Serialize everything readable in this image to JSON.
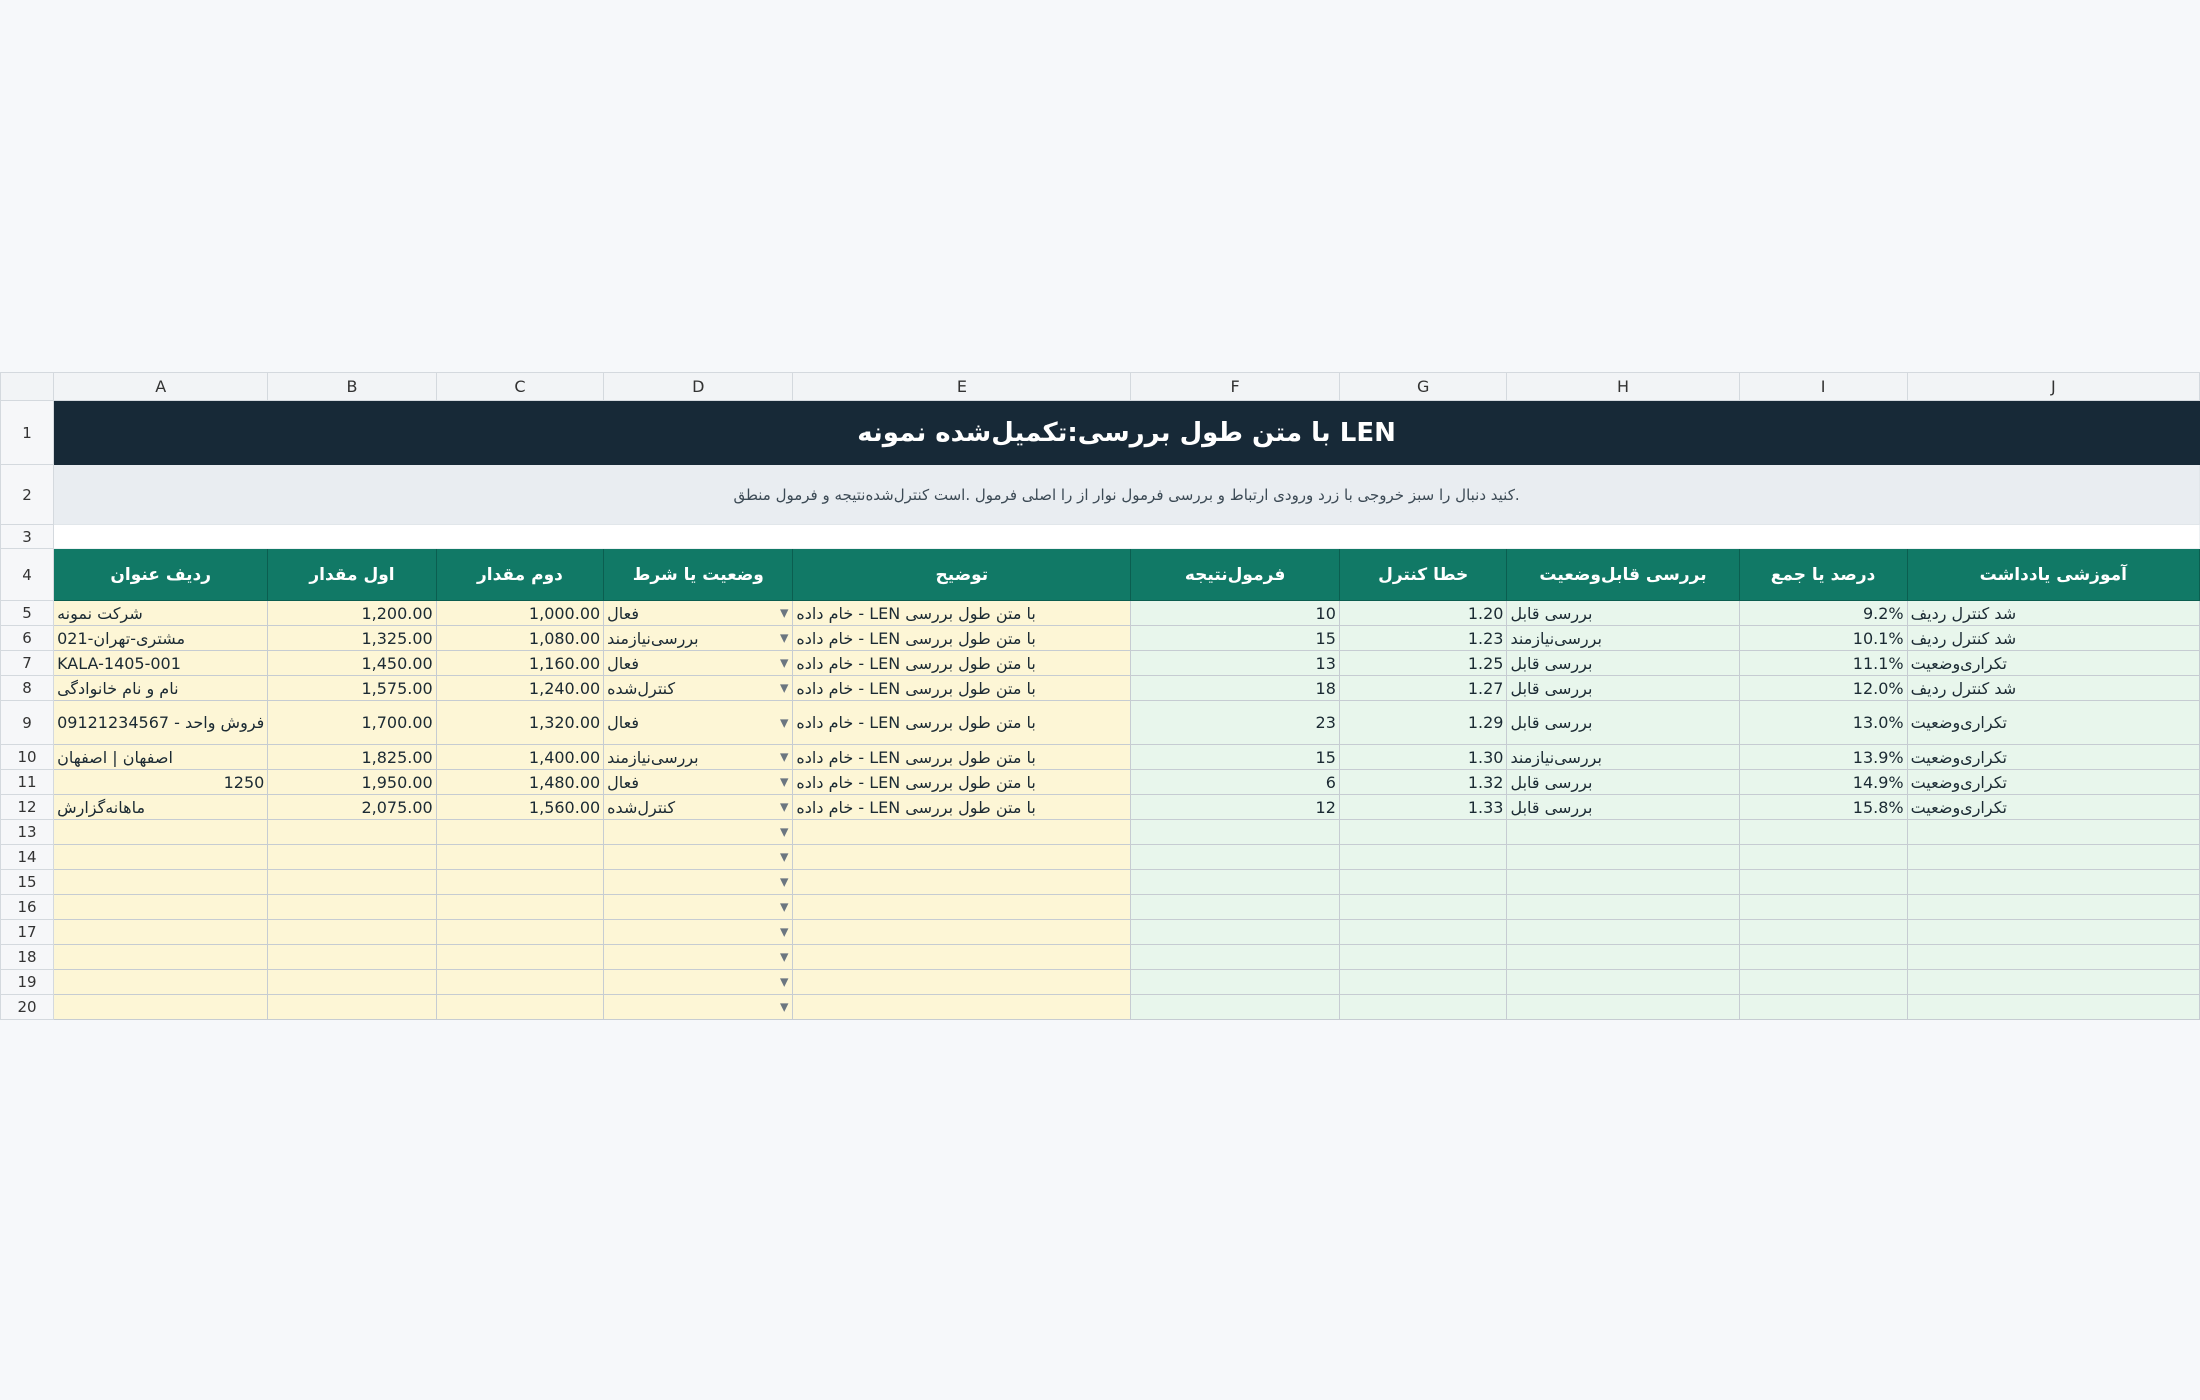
{
  "columns": [
    "A",
    "B",
    "C",
    "D",
    "E",
    "F",
    "G",
    "H",
    "I",
    "J"
  ],
  "title": "LEN با متن طول بررسی:تکمیل‌شده نمونه",
  "note": ".کنید دنبال را سبز خروجی با زرد ورودی ارتباط و بررسی فرمول نوار از را اصلی فرمول .است کنترل‌شده‌نتیجه و فرمول منطق",
  "headers": [
    "ردیف عنوان",
    "اول مقدار",
    "دوم مقدار",
    "وضعیت یا شرط",
    "توضیح",
    "فرمول‌نتیجه",
    "خطا کنترل",
    "بررسی قابل‌وضعیت",
    "درصد یا جمع",
    "آموزشی یادداشت"
  ],
  "rows": [
    {
      "n": "5",
      "a": "شرکت   نمونه",
      "b": "1,200.00",
      "c": "1,000.00",
      "d": "فعال",
      "e": "خام داده - LEN با متن طول بررسی",
      "f": "10",
      "g": "1.20",
      "h": "بررسی قابل",
      "i": "9.2%",
      "j": "شد کنترل ردیف"
    },
    {
      "n": "6",
      "a": "مشتری-تهران-021",
      "b": "1,325.00",
      "c": "1,080.00",
      "d": "بررسی‌نیازمند",
      "e": "خام داده - LEN با متن طول بررسی",
      "f": "15",
      "g": "1.23",
      "h": "بررسی‌نیازمند",
      "i": "10.1%",
      "j": "شد کنترل ردیف"
    },
    {
      "n": "7",
      "a": "KALA-1405-001",
      "b": "1,450.00",
      "c": "1,160.00",
      "d": "فعال",
      "e": "خام داده - LEN با متن طول بررسی",
      "f": "13",
      "g": "1.25",
      "h": "بررسی قابل",
      "i": "11.1%",
      "j": "تکراری‌وضعیت"
    },
    {
      "n": "8",
      "a": "نام و نام خانوادگی",
      "b": "1,575.00",
      "c": "1,240.00",
      "d": "کنترل‌شده",
      "e": "خام داده - LEN با متن طول بررسی",
      "f": "18",
      "g": "1.27",
      "h": "بررسی قابل",
      "i": "12.0%",
      "j": "شد کنترل ردیف"
    },
    {
      "n": "9",
      "a": "فروش واحد - 09121234567",
      "b": "1,700.00",
      "c": "1,320.00",
      "d": "فعال",
      "e": "خام داده - LEN با متن طول بررسی",
      "f": "23",
      "g": "1.29",
      "h": "بررسی قابل",
      "i": "13.0%",
      "j": "تکراری‌وضعیت"
    },
    {
      "n": "10",
      "a": "اصفهان | اصفهان",
      "b": "1,825.00",
      "c": "1,400.00",
      "d": "بررسی‌نیازمند",
      "e": "خام داده - LEN با متن طول بررسی",
      "f": "15",
      "g": "1.30",
      "h": "بررسی‌نیازمند",
      "i": "13.9%",
      "j": "تکراری‌وضعیت"
    },
    {
      "n": "11",
      "a": "1250",
      "b": "1,950.00",
      "c": "1,480.00",
      "d": "فعال",
      "e": "خام داده - LEN با متن طول بررسی",
      "f": "6",
      "g": "1.32",
      "h": "بررسی قابل",
      "i": "14.9%",
      "j": "تکراری‌وضعیت"
    },
    {
      "n": "12",
      "a": "ماهانه‌گزارش",
      "b": "2,075.00",
      "c": "1,560.00",
      "d": "کنترل‌شده",
      "e": "خام داده - LEN با متن طول بررسی",
      "f": "12",
      "g": "1.33",
      "h": "بررسی قابل",
      "i": "15.8%",
      "j": "تکراری‌وضعیت"
    }
  ],
  "empty_rows": [
    "13",
    "14",
    "15",
    "16",
    "17",
    "18",
    "19",
    "20"
  ],
  "colors": {
    "title_bg": "#172937",
    "header_bg": "#117966",
    "input_bg": "#fdf6d6",
    "output_bg": "#e8f6ec"
  },
  "icons": {
    "dropdown": "▼"
  }
}
